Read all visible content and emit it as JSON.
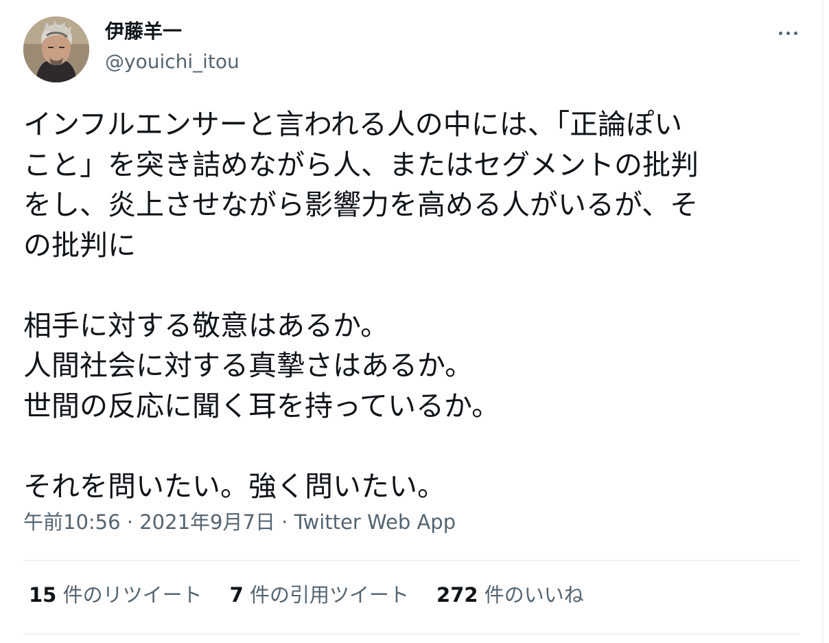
{
  "author": {
    "display_name": "伊藤羊一",
    "handle": "@youichi_itou",
    "avatar_icon": "avatar-photo"
  },
  "more_icon": "more-options-icon",
  "tweet": {
    "paragraph1": [
      "インフルエンサーと言われる人の中には、「正論ぽい",
      "こと」を突き詰めながら人、またはセグメントの批判",
      "をし、炎上させながら影響力を高める人がいるが、そ",
      "の批判に"
    ],
    "paragraph2": [
      "相手に対する敬意はあるか。",
      "人間社会に対する真摯さはあるか。",
      "世間の反応に聞く耳を持っているか。"
    ],
    "paragraph3": [
      "それを問いたい。強く問いたい。"
    ]
  },
  "meta": {
    "time": "午前10:56",
    "separator": " · ",
    "date": "2021年9月7日",
    "source": "Twitter Web App"
  },
  "stats": {
    "retweets_count": "15",
    "retweets_label": "件のリツイート",
    "quotes_count": "7",
    "quotes_label": "件の引用ツイート",
    "likes_count": "272",
    "likes_label": "件のいいね"
  },
  "colors": {
    "text_primary": "#0f1419",
    "text_secondary": "#536471",
    "divider": "#eff3f4"
  }
}
